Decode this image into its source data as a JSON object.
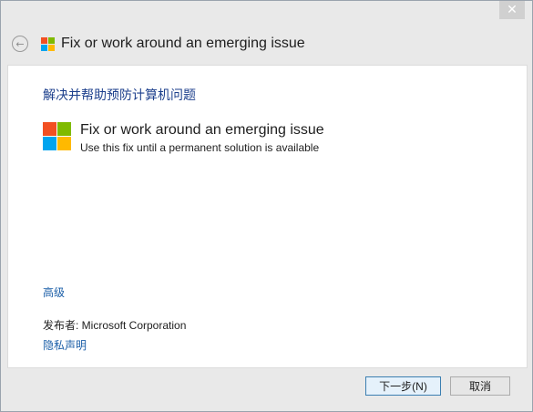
{
  "window": {
    "close_glyph": "✕"
  },
  "header": {
    "back_glyph": "←",
    "title": "Fix or work around an emerging issue"
  },
  "content": {
    "heading": "解决并帮助预防计算机问题",
    "option": {
      "title": "Fix or work around an emerging issue",
      "description": "Use this fix until a permanent solution is available"
    },
    "advanced_link": "高级",
    "publisher_text": "发布者:  Microsoft Corporation",
    "privacy_link": "隐私声明"
  },
  "footer": {
    "next_label": "下一步(N)",
    "cancel_label": "取消"
  },
  "colors": {
    "logo_red": "#f25022",
    "logo_green": "#7fba00",
    "logo_blue": "#00a4ef",
    "logo_yellow": "#ffb900",
    "heading_blue": "#1c3f8c",
    "link_blue": "#1c5fa8"
  },
  "icons": {
    "back": "back-arrow-icon",
    "logo": "microsoft-logo-icon",
    "close": "close-icon"
  }
}
